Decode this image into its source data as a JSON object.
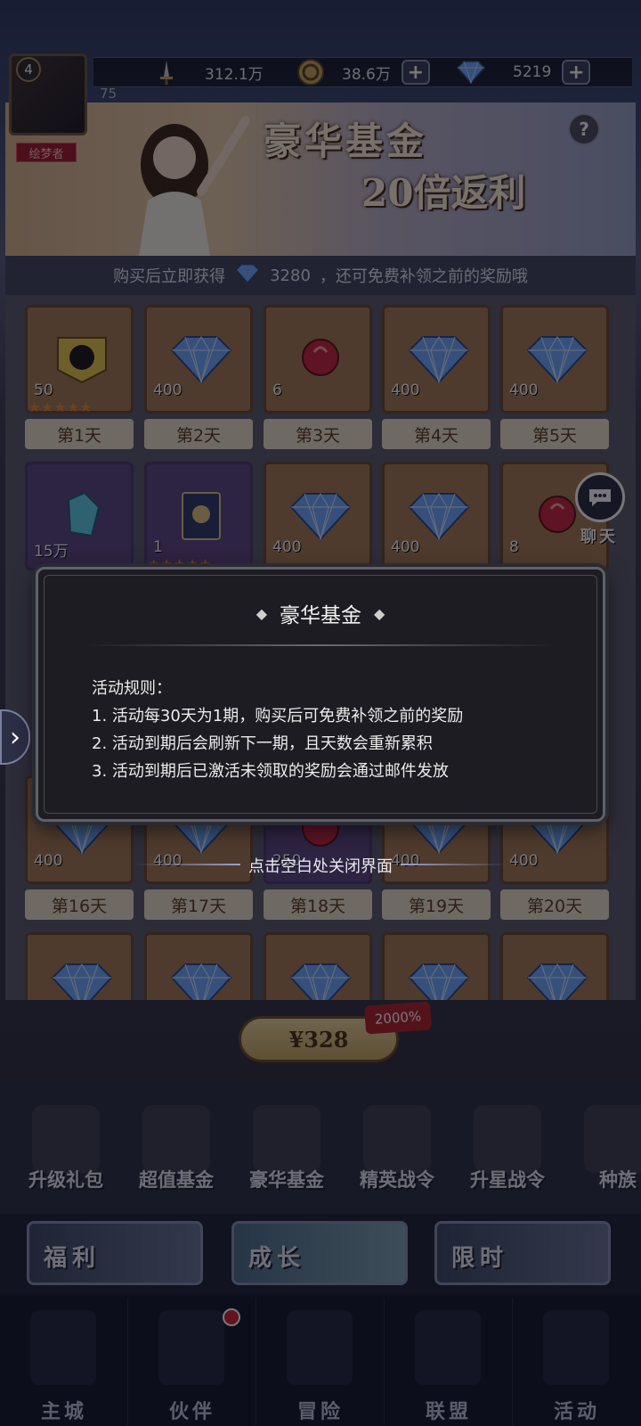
{
  "resources": {
    "power": "312.1万",
    "gold": "38.6万",
    "diamonds": "5219"
  },
  "player": {
    "level": "4",
    "level_progress": "75",
    "title_tag": "绘梦者"
  },
  "banner": {
    "title_line1": "豪华基金",
    "title_line2": "20倍返利",
    "help": "?"
  },
  "notice": {
    "prefix": "购买后立即获得",
    "amount": "3280",
    "suffix": "，还可免费补领之前的奖励哦"
  },
  "rewards": [
    {
      "day": "第1天",
      "amount": "50",
      "stars": "★★★★★",
      "kind": "hero"
    },
    {
      "day": "第2天",
      "amount": "400",
      "stars": "",
      "kind": "diamond"
    },
    {
      "day": "第3天",
      "amount": "6",
      "stars": "",
      "kind": "item"
    },
    {
      "day": "第4天",
      "amount": "400",
      "stars": "",
      "kind": "diamond"
    },
    {
      "day": "第5天",
      "amount": "400",
      "stars": "",
      "kind": "diamond"
    },
    {
      "day": "",
      "amount": "15万",
      "stars": "",
      "kind": "crystal"
    },
    {
      "day": "",
      "amount": "1",
      "stars": "★★★★★",
      "kind": "card"
    },
    {
      "day": "",
      "amount": "400",
      "stars": "",
      "kind": "diamond"
    },
    {
      "day": "",
      "amount": "400",
      "stars": "",
      "kind": "diamond"
    },
    {
      "day": "",
      "amount": "8",
      "stars": "",
      "kind": "item"
    },
    {
      "day": "第16天",
      "amount": "400",
      "stars": "",
      "kind": "diamond"
    },
    {
      "day": "第17天",
      "amount": "400",
      "stars": "",
      "kind": "diamond"
    },
    {
      "day": "第18天",
      "amount": "250",
      "stars": "",
      "kind": "item"
    },
    {
      "day": "第19天",
      "amount": "400",
      "stars": "",
      "kind": "diamond"
    },
    {
      "day": "第20天",
      "amount": "400",
      "stars": "",
      "kind": "diamond"
    }
  ],
  "purchase": {
    "price": "¥328",
    "bonus": "2000%"
  },
  "categories": [
    "升级礼包",
    "超值基金",
    "豪华基金",
    "精英战令",
    "升星战令",
    "种族"
  ],
  "subnav": [
    "福利",
    "成长",
    "限时"
  ],
  "bottomnav": [
    "主城",
    "伙伴",
    "冒险",
    "联盟",
    "活动"
  ],
  "chat": {
    "label": "聊天"
  },
  "modal": {
    "title": "豪华基金",
    "rules_heading": "活动规则：",
    "rules": [
      "1. 活动每30天为1期，购买后可免费补领之前的奖励",
      "2. 活动到期后会刷新下一期，且天数会重新累积",
      "3. 活动到期后已激活未领取的奖励会通过邮件发放"
    ],
    "close_hint": "点击空白处关闭界面"
  },
  "colors": {
    "diamond": "#6fa8ff",
    "day_label_bg": "#ece1c8",
    "modal_bg": "#1c1c22",
    "price_bg": "#ecd69a",
    "badge_red": "#b2232a"
  }
}
